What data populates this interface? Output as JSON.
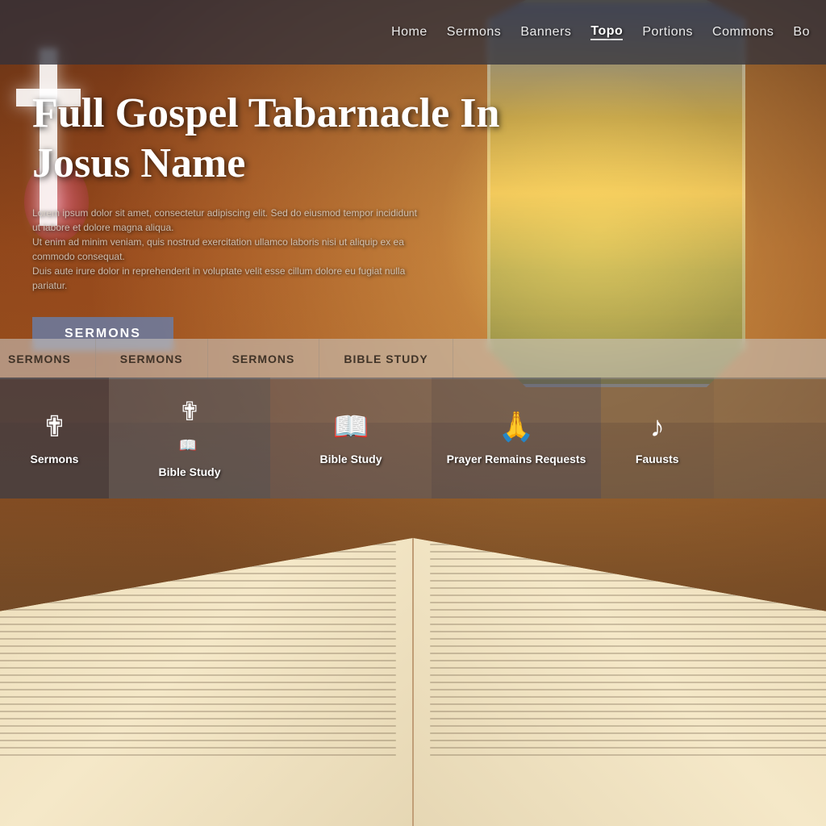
{
  "navbar": {
    "items": [
      {
        "label": "Home",
        "active": false
      },
      {
        "label": "Sermons",
        "active": false
      },
      {
        "label": "Banners",
        "active": false
      },
      {
        "label": "Topo",
        "active": true
      },
      {
        "label": "Portions",
        "active": false
      },
      {
        "label": "Commons",
        "active": false
      },
      {
        "label": "Bo",
        "active": false
      }
    ]
  },
  "hero": {
    "title": "Full Gospel Tabarnacle In Josus Name",
    "description_line1": "Lorem ipsum dolor sit amet, consectetur adipiscing elit. Sed do eiusmod tempor incididunt ut labore et dolore magna aliqua.",
    "description_line2": "Ut enim ad minim veniam, quis nostrud exercitation ullamco laboris nisi ut aliquip ex ea commodo consequat.",
    "description_line3": "Duis aute irure dolor in reprehenderit in voluptate velit esse cillum dolore eu fugiat nulla pariatur.",
    "sermons_button": "SERMONS"
  },
  "sub_nav": {
    "items": [
      {
        "label": "SERMONS"
      },
      {
        "label": "SERMONS"
      },
      {
        "label": "SERMONS"
      },
      {
        "label": "BIBLE STUDY"
      }
    ]
  },
  "cards": [
    {
      "icon": "✟",
      "label": "Sermons",
      "icon_name": "cross-icon"
    },
    {
      "icon": "✟",
      "label": "Bible Study",
      "icon_name": "book-icon"
    },
    {
      "icon": "📖",
      "label": "Bible Study",
      "icon_name": "open-book-icon"
    },
    {
      "icon": "🙏",
      "label": "Prayer Remains Requests",
      "icon_name": "prayer-icon"
    },
    {
      "icon": "🎵",
      "label": "Fauusts",
      "icon_name": "music-icon"
    },
    {
      "icon": "",
      "label": "",
      "icon_name": "empty-icon"
    }
  ],
  "colors": {
    "navbar_bg": "rgba(50,50,60,0.75)",
    "sub_nav_bg": "rgba(200,195,190,0.6)",
    "card_dark": "rgba(60,60,70,0.75)",
    "sermons_btn": "rgba(100,130,180,0.75)"
  }
}
